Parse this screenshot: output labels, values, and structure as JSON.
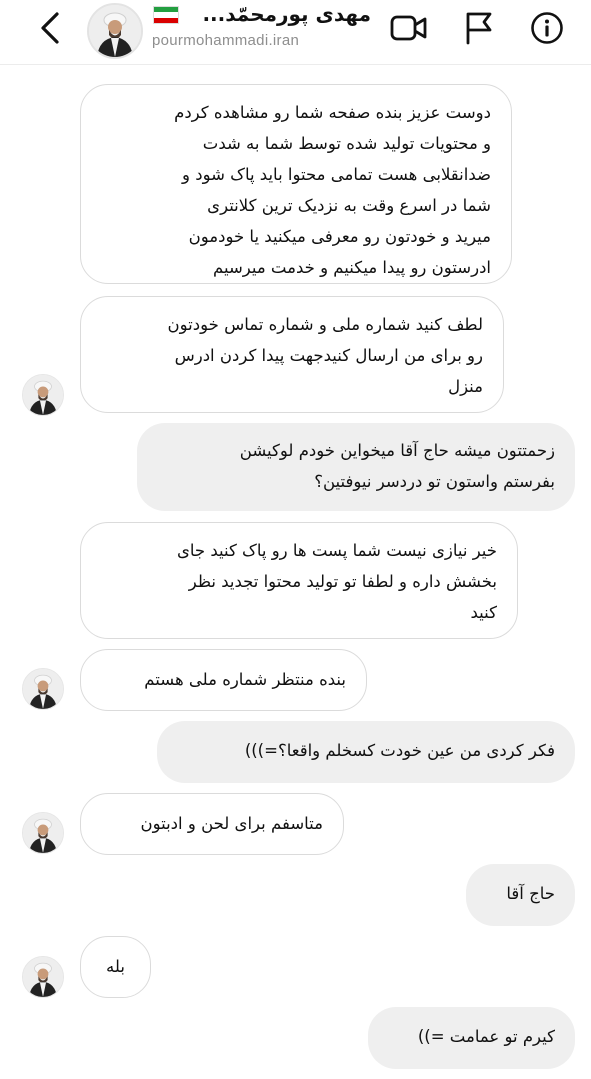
{
  "header": {
    "name": "مهدی پورمحمّد...",
    "username": "pourmohammadi.iran",
    "flag_colors": [
      "#239f40",
      "#ffffff",
      "#da0000"
    ]
  },
  "messages": [
    {
      "direction": "incoming",
      "lines": [
        "دوست عزیز بنده صفحه شما رو مشاهده کردم",
        "و محتویات تولید شده توسط شما به شدت",
        "ضدانقلابی هست تمامی محتوا باید پاک شود و",
        "شما در اسرع وقت به نزدیک ترین کلانتری",
        "میرید و خودتون رو معرفی میکنید یا خودمون",
        "ادرستون رو پیدا میکنیم و خدمت میرسیم"
      ]
    },
    {
      "direction": "incoming",
      "lines": [
        "لطف کنید شماره ملی و شماره تماس خودتون",
        "رو برای من ارسال کنیدجهت پیدا کردن ادرس",
        "منزل"
      ]
    },
    {
      "direction": "outgoing",
      "lines": [
        "زحمتتون میشه حاج آقا میخواین خودم لوکیشن",
        "بفرستم واستون تو دردسر نیوفتین؟"
      ]
    },
    {
      "direction": "incoming",
      "lines": [
        "خیر نیازی نیست شما پست ها رو پاک کنید جای",
        "بخشش داره و لطفا تو تولید محتوا تجدید نظر",
        "کنید"
      ]
    },
    {
      "direction": "incoming",
      "lines": [
        "بنده منتظر شماره ملی هستم"
      ]
    },
    {
      "direction": "outgoing",
      "lines": [
        "فکر کردی من عین خودت کسخلم واقعا؟=)))"
      ]
    },
    {
      "direction": "incoming",
      "lines": [
        "متاسفم برای لحن و ادبتون"
      ]
    },
    {
      "direction": "outgoing",
      "lines": [
        "حاج آقا"
      ]
    },
    {
      "direction": "incoming",
      "lines": [
        "بله"
      ]
    },
    {
      "direction": "outgoing",
      "lines": [
        "کیرم تو عمامت =))"
      ]
    }
  ]
}
